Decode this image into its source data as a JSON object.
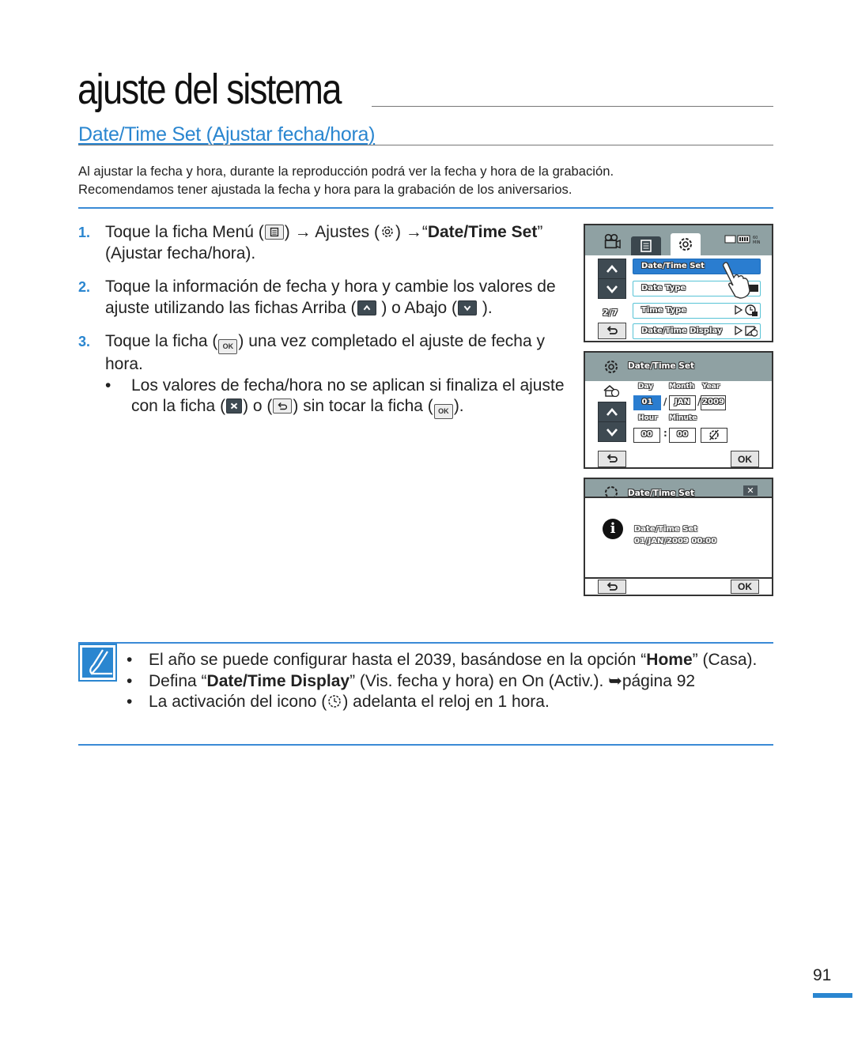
{
  "chapter_title": "ajuste del sistema",
  "section_title": "Date/Time Set (Ajustar fecha/hora)",
  "intro": [
    "Al ajustar la fecha y hora, durante la reproducción podrá ver la fecha y hora de la grabación.",
    "Recomendamos tener ajustada la fecha y hora para la grabación de los aniversarios."
  ],
  "steps": [
    {
      "num": "1.",
      "t1": "Toque la ficha Menú (",
      "t2": ") → Ajustes (",
      "t3": ") →“",
      "bold": "Date/Time Set",
      "t4": "” (Ajustar fecha/hora)."
    },
    {
      "num": "2.",
      "t1": "Toque la información de fecha y hora y cambie los valores de ajuste utilizando las fichas Arriba (",
      "t2": " ) o Abajo (",
      "t3": " )."
    },
    {
      "num": "3.",
      "t1": "Toque la ficha (",
      "t2": ") una vez completado el ajuste de fecha y hora.",
      "bullet": {
        "dot": "•",
        "t1": "Los valores de fecha/hora no se aplican si finaliza el ajuste con la ficha (",
        "t2": ") o (",
        "t3": ") sin tocar la ficha (",
        "t4": ")."
      }
    }
  ],
  "icons": {
    "ok_label": "OK"
  },
  "screen1": {
    "menu_items": [
      {
        "label": "Date/Time Set",
        "active": true
      },
      {
        "label": "Date Type"
      },
      {
        "label": "Time Type"
      },
      {
        "label": "Date/Time Display"
      }
    ],
    "page_indicator": "2/7",
    "status_icons": "card battery 60MIN"
  },
  "screen2": {
    "title": "Date/Time Set",
    "labels": {
      "day": "Day",
      "month": "Month",
      "year": "Year",
      "hour": "Hour",
      "minute": "Minute"
    },
    "values": {
      "day": "01",
      "month": "JAN",
      "year": "2009",
      "hour": "00",
      "minute": "00"
    },
    "sep_date": "/",
    "sep_time": ":",
    "ok": "OK"
  },
  "screen3": {
    "title": "Date/Time Set",
    "close": "✕",
    "message_line1": "Date/Time Set",
    "message_line2": "01/JAN/2009 00:00",
    "ok": "OK"
  },
  "notes": [
    {
      "dot": "•",
      "t1": "El año se puede configurar hasta el 2039, basándose en la opción “",
      "bold": "Home",
      "t2": "” (Casa)."
    },
    {
      "dot": "•",
      "t1": "Defina “",
      "bold": "Date/Time Display",
      "t2": "” (Vis. fecha y hora) en On (Activ.). ➥página 92"
    },
    {
      "dot": "•",
      "t1": "La activación del icono (",
      "t2": ") adelanta el reloj en 1 hora."
    }
  ],
  "page_number": "91"
}
